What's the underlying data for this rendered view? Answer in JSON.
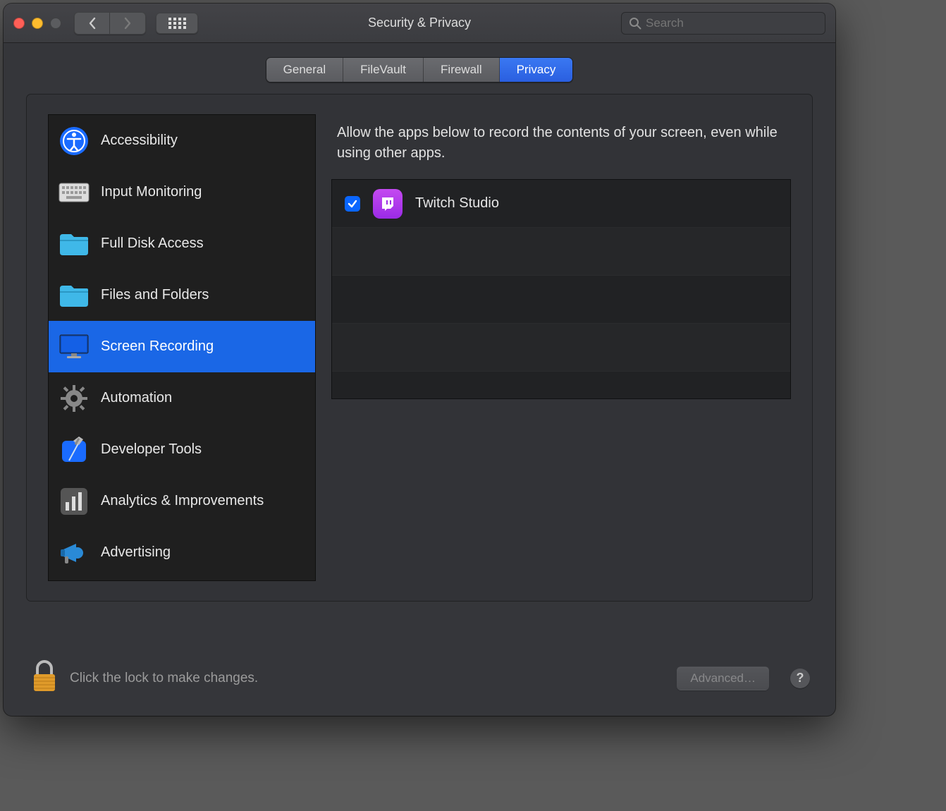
{
  "window": {
    "title": "Security & Privacy"
  },
  "search": {
    "placeholder": "Search"
  },
  "tabs": [
    {
      "label": "General",
      "active": false
    },
    {
      "label": "FileVault",
      "active": false
    },
    {
      "label": "Firewall",
      "active": false
    },
    {
      "label": "Privacy",
      "active": true
    }
  ],
  "sidebar": {
    "items": [
      {
        "label": "Accessibility",
        "icon": "accessibility-icon",
        "selected": false
      },
      {
        "label": "Input Monitoring",
        "icon": "keyboard-icon",
        "selected": false
      },
      {
        "label": "Full Disk Access",
        "icon": "folder-icon",
        "selected": false
      },
      {
        "label": "Files and Folders",
        "icon": "folder-icon",
        "selected": false
      },
      {
        "label": "Screen Recording",
        "icon": "display-icon",
        "selected": true
      },
      {
        "label": "Automation",
        "icon": "gear-icon",
        "selected": false
      },
      {
        "label": "Developer Tools",
        "icon": "hammer-icon",
        "selected": false
      },
      {
        "label": "Analytics & Improvements",
        "icon": "chart-icon",
        "selected": false
      },
      {
        "label": "Advertising",
        "icon": "megaphone-icon",
        "selected": false
      }
    ]
  },
  "detail": {
    "description": "Allow the apps below to record the contents of your screen, even while using other apps.",
    "apps": [
      {
        "name": "Twitch Studio",
        "checked": true,
        "icon": "twitch-icon"
      }
    ]
  },
  "footer": {
    "lock_message": "Click the lock to make changes.",
    "advanced_label": "Advanced…",
    "help_label": "?"
  }
}
